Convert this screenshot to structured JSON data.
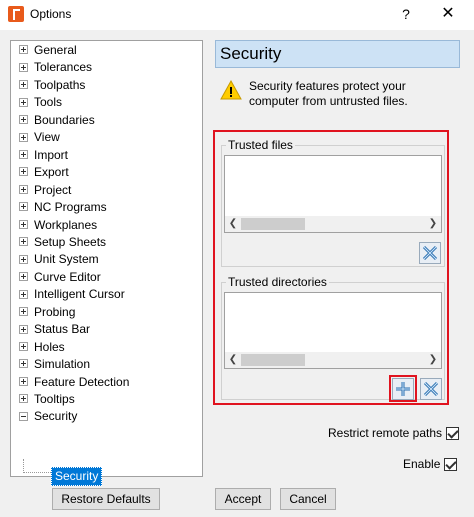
{
  "window": {
    "title": "Options",
    "help_label": "?",
    "close_label": "✕"
  },
  "tree": {
    "items": [
      "General",
      "Tolerances",
      "Toolpaths",
      "Tools",
      "Boundaries",
      "View",
      "Import",
      "Export",
      "Project",
      "NC Programs",
      "Workplanes",
      "Setup Sheets",
      "Unit System",
      "Curve Editor",
      "Intelligent Cursor",
      "Probing",
      "Status Bar",
      "Holes",
      "Simulation",
      "Feature Detection",
      "Tooltips",
      "Security"
    ],
    "selected_child": "Security"
  },
  "panel": {
    "title": "Security",
    "warning_text": "Security features protect your computer from untrusted files.",
    "trusted_files_label": "Trusted files",
    "trusted_dirs_label": "Trusted directories",
    "restrict_remote_label": "Restrict remote paths",
    "restrict_remote_checked": true,
    "enable_label": "Enable",
    "enable_checked": true
  },
  "buttons": {
    "restore_defaults": "Restore Defaults",
    "accept": "Accept",
    "cancel": "Cancel"
  },
  "colors": {
    "highlight": "#e0131f",
    "selection": "#0078d7",
    "header": "#cde2f5"
  }
}
